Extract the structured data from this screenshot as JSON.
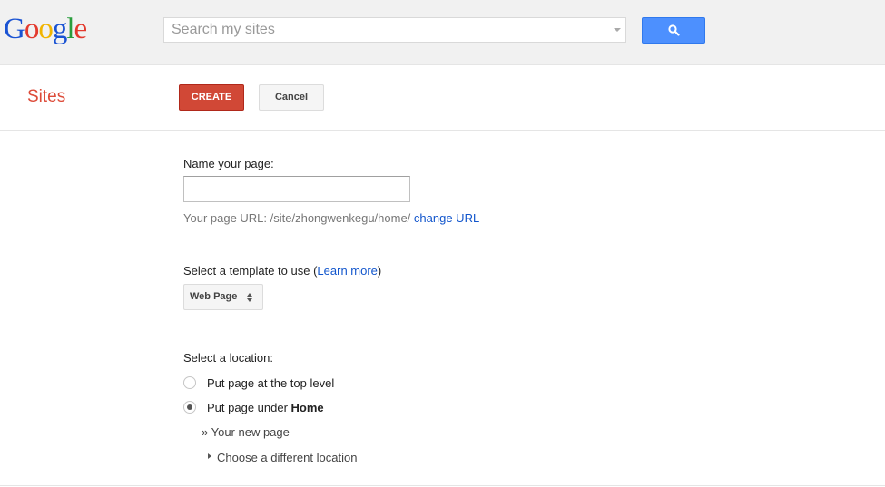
{
  "header": {
    "logo_letters": [
      "G",
      "o",
      "o",
      "g",
      "l",
      "e"
    ],
    "logo_colors": [
      "#1a53d3",
      "#e33a2e",
      "#f1b400",
      "#1a53d3",
      "#2a9d3d",
      "#e33a2e"
    ],
    "search_placeholder": "Search my sites",
    "search_button_icon": "search-icon"
  },
  "toolbar": {
    "app_title": "Sites",
    "create_label": "CREATE",
    "cancel_label": "Cancel"
  },
  "form": {
    "name_label": "Name your page:",
    "name_value": "",
    "url_prefix": "Your page URL: /site/zhongwenkegu/home/",
    "change_url_label": "change URL",
    "template_label_start": "Select a template to use (",
    "learn_more_label": "Learn more",
    "template_label_end": ")",
    "template_selected": "Web Page",
    "location_label": "Select a location:",
    "option_top_level": "Put page at the top level",
    "option_under_prefix": "Put page under ",
    "option_under_target": "Home",
    "selected_option": "under",
    "new_page_line": "» Your new page",
    "choose_location_label": "Choose a different location"
  },
  "colors": {
    "accent_red": "#dd4b39",
    "create_button": "#d14836",
    "search_button": "#4d90fe",
    "link": "#15c"
  }
}
